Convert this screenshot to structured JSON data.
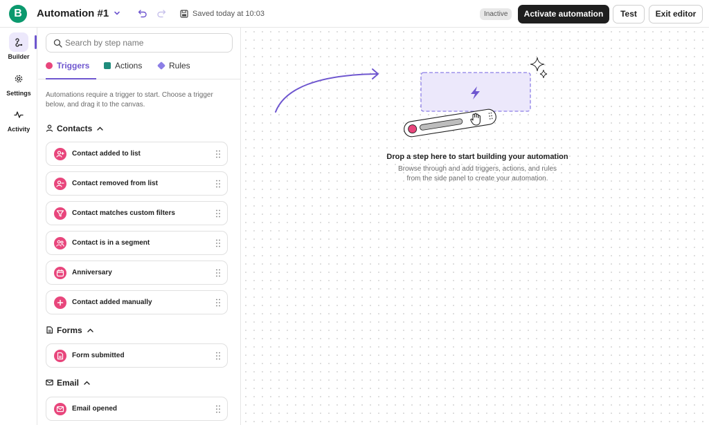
{
  "header": {
    "logo_letter": "B",
    "title": "Automation #1",
    "saved": "Saved today at 10:03",
    "status_badge": "Inactive",
    "activate_label": "Activate automation",
    "test_label": "Test",
    "exit_label": "Exit editor"
  },
  "rail": {
    "items": [
      {
        "label": "Builder",
        "icon": "builder-icon",
        "active": true
      },
      {
        "label": "Settings",
        "icon": "gear-icon",
        "active": false
      },
      {
        "label": "Activity",
        "icon": "activity-icon",
        "active": false
      }
    ]
  },
  "panel": {
    "search_placeholder": "Search by step name",
    "tabs": [
      {
        "label": "Triggers",
        "active": true,
        "color": "#e8467c"
      },
      {
        "label": "Actions",
        "active": false,
        "color": "#1f8c7c"
      },
      {
        "label": "Rules",
        "active": false,
        "color": "#8c7ee6"
      }
    ],
    "helper": "Automations require a trigger to start. Choose a trigger below, and drag it to the canvas.",
    "sections": [
      {
        "title": "Contacts",
        "icon": "person-icon"
      },
      {
        "title": "Forms",
        "icon": "document-icon"
      },
      {
        "title": "Email",
        "icon": "envelope-icon"
      }
    ],
    "triggers": [
      {
        "label": "Contact added to list",
        "icon": "person-plus-icon"
      },
      {
        "label": "Contact removed from list",
        "icon": "person-minus-icon"
      },
      {
        "label": "Contact matches custom filters",
        "icon": "filter-icon"
      },
      {
        "label": "Contact is in a segment",
        "icon": "people-icon"
      },
      {
        "label": "Anniversary",
        "icon": "calendar-icon"
      },
      {
        "label": "Contact added manually",
        "icon": "plus-icon"
      },
      {
        "label": "Form submitted",
        "icon": "document-icon"
      },
      {
        "label": "Email opened",
        "icon": "envelope-icon"
      }
    ]
  },
  "canvas": {
    "drop_title": "Drop a step here to start building your automation",
    "drop_sub_line1": "Browse through and add triggers, actions, and rules",
    "drop_sub_line2": "from the side panel to create your automation.",
    "accent_color": "#6e56cf"
  }
}
